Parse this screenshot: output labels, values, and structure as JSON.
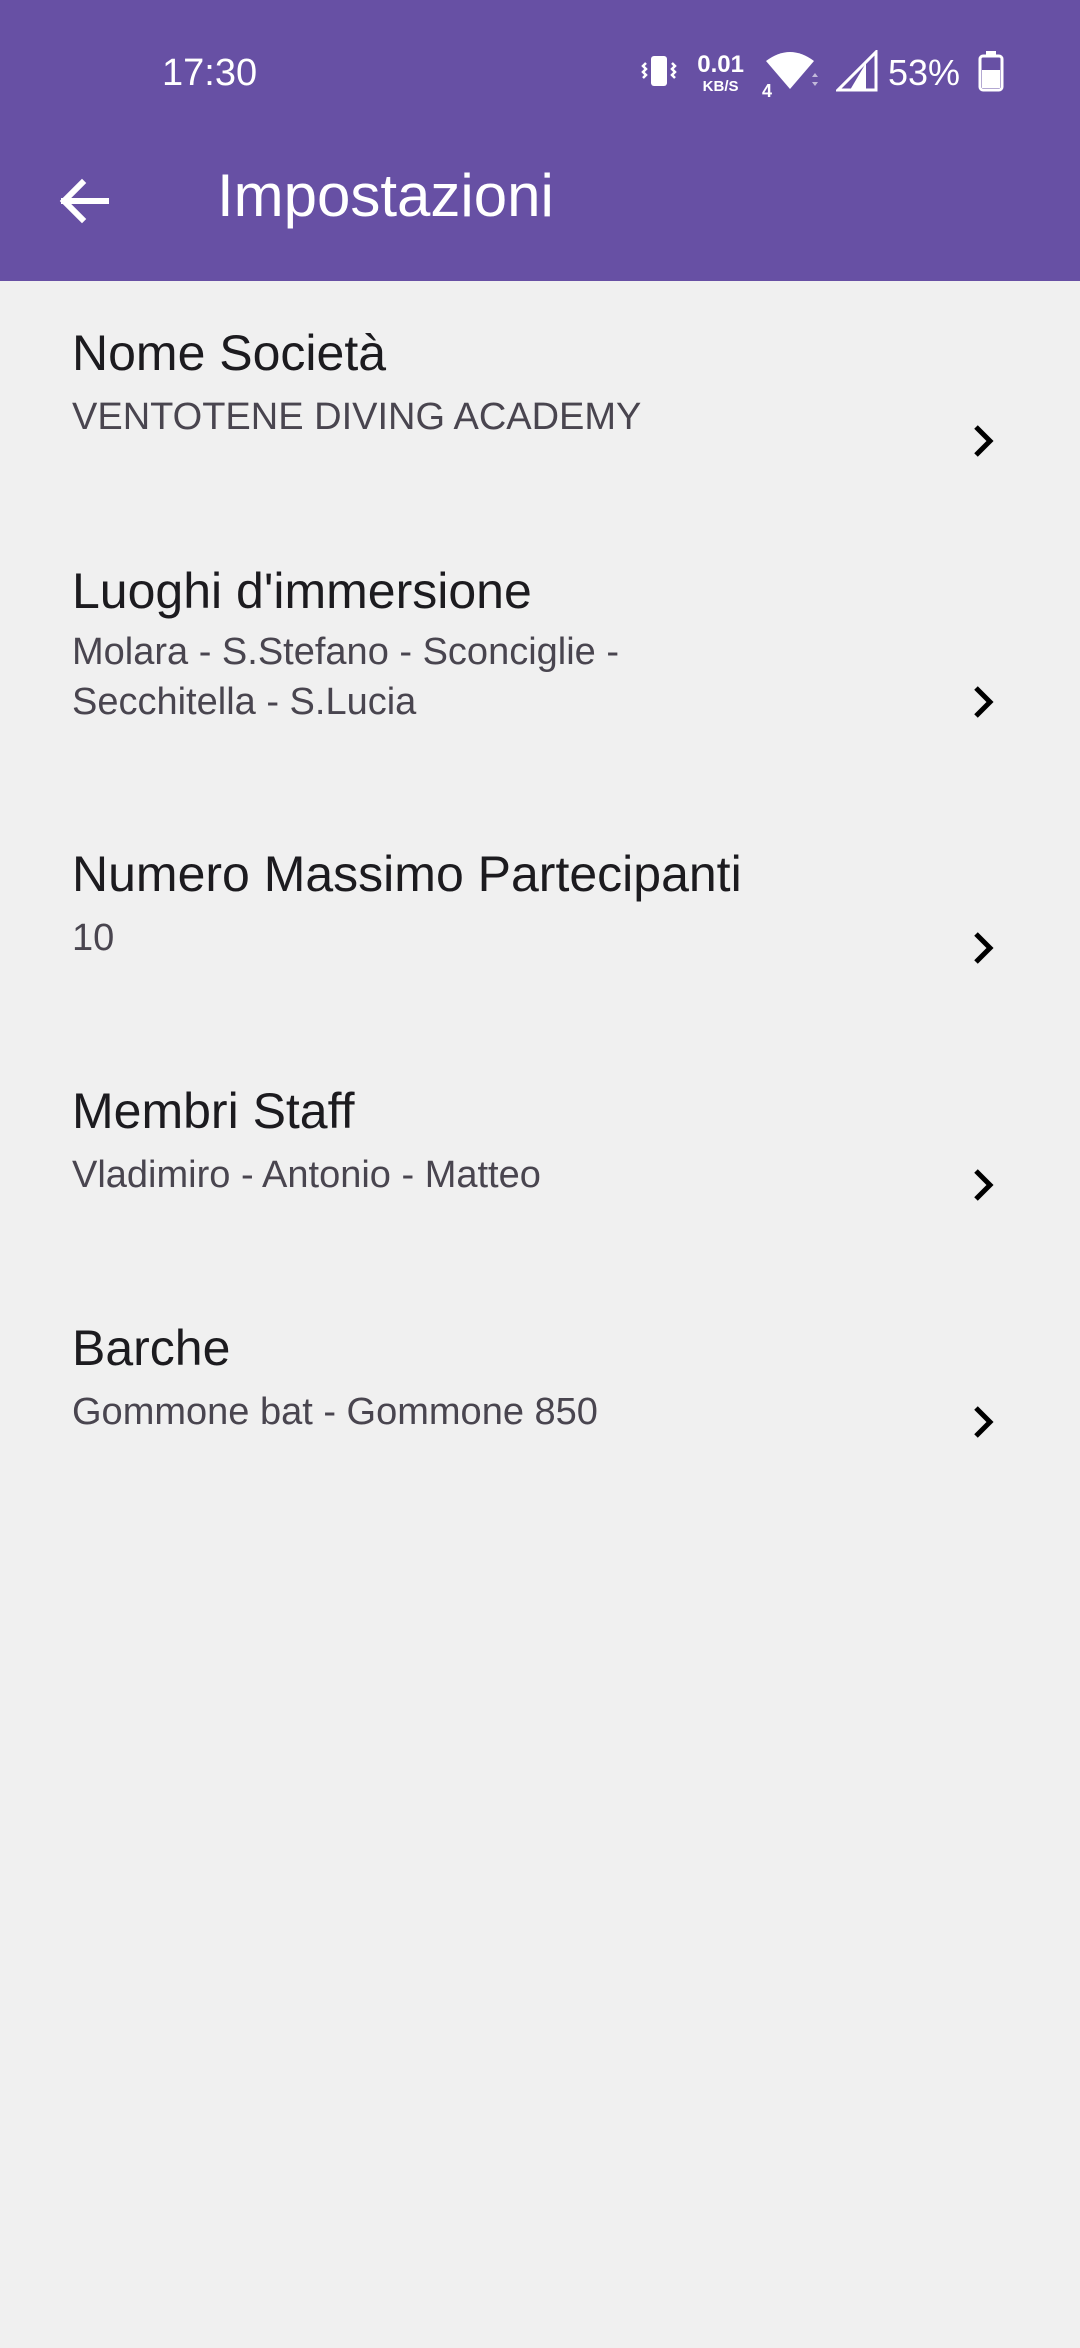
{
  "status_bar": {
    "time": "17:30",
    "net_speed_value": "0.01",
    "net_speed_unit": "KB/S",
    "signal_sub": "4",
    "battery_percent": "53%",
    "icons": [
      "vibrate-icon",
      "wifi-icon",
      "cellular-signal-icon",
      "battery-icon"
    ]
  },
  "appbar": {
    "title": "Impostazioni",
    "back_icon": "arrow-back-icon",
    "color": "#6750a4"
  },
  "settings": [
    {
      "title": "Nome Società",
      "value": "VENTOTENE DIVING ACADEMY"
    },
    {
      "title": "Luoghi d'immersione",
      "value_lines": [
        "Molara - S.Stefano - Sconciglie -",
        "Secchitella - S.Lucia"
      ]
    },
    {
      "title": "Numero Massimo Partecipanti",
      "value": "10"
    },
    {
      "title": "Membri Staff",
      "value": "Vladimiro - Antonio  - Matteo"
    },
    {
      "title": "Barche",
      "value": "Gommone bat - Gommone 850"
    }
  ]
}
